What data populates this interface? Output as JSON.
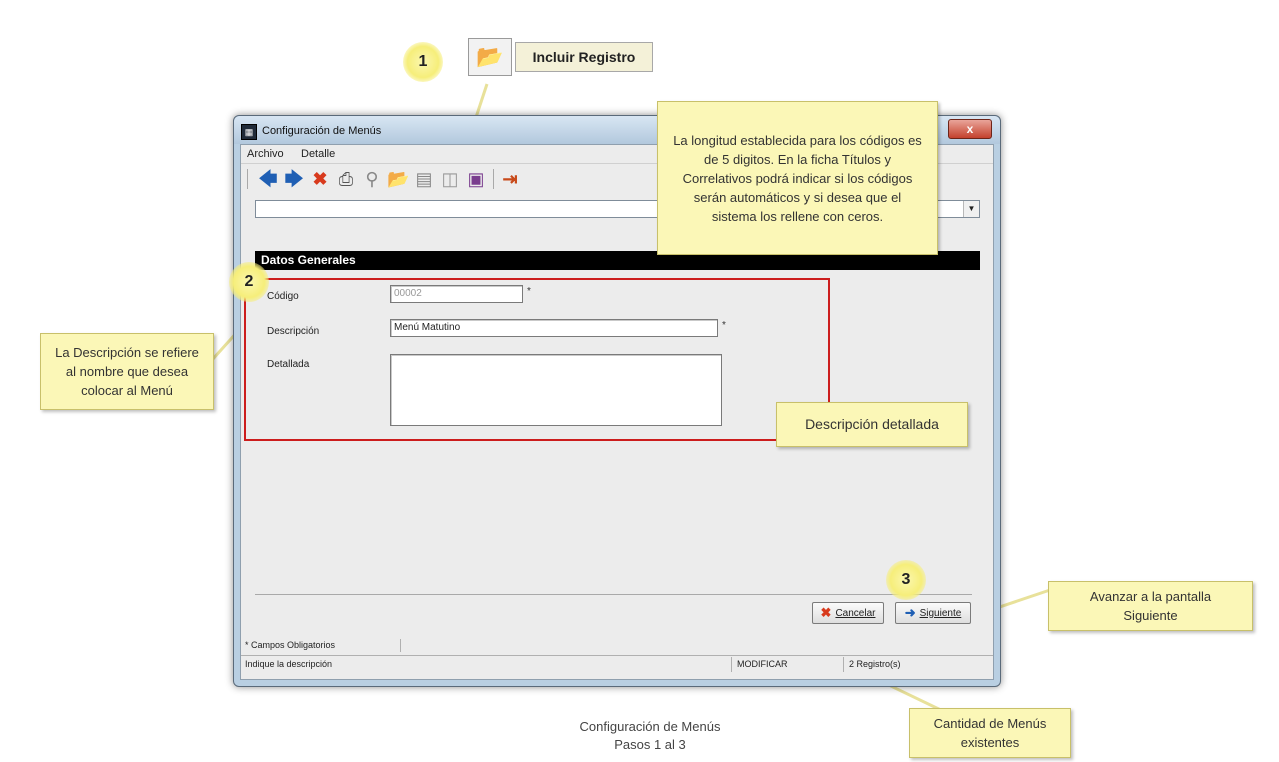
{
  "callout_top": {
    "step": "1",
    "button_label": "Incluir Registro"
  },
  "window": {
    "title": "Configuración de Menús",
    "close": "x",
    "menu": [
      "Archivo",
      "Detalle"
    ],
    "section_header": "Datos Generales",
    "fields": {
      "codigo_label": "Código",
      "codigo_value": "00002",
      "descripcion_label": "Descripción",
      "descripcion_value": "Menú Matutino",
      "detallada_label": "Detallada",
      "detallada_value": "",
      "required_mark": "*"
    },
    "buttons": {
      "cancel": "Cancelar",
      "next": "Siguiente"
    },
    "required_note": "* Campos Obligatorios",
    "status": {
      "hint": "Indique la descripción",
      "mode": "MODIFICAR",
      "count": "2 Registro(s)"
    }
  },
  "steps": {
    "two": "2",
    "three": "3"
  },
  "notes": {
    "codigo": "La longitud  establecida para los códigos es de 5 digitos. En la ficha Títulos y Correlativos podrá indicar si los códigos serán automáticos y si desea que el sistema los rellene con ceros.",
    "descripcion": "La Descripción se refiere al nombre que desea colocar al Menú",
    "detallada": "Descripción detallada",
    "siguiente": "Avanzar a la pantalla Siguiente",
    "cantidad": "Cantidad de Menús existentes"
  },
  "caption": {
    "line1": "Configuración de Menús",
    "line2": "Pasos 1 al 3"
  },
  "icons": [
    "back-arrow-icon",
    "forward-arrow-icon",
    "cancel-x-icon",
    "print-icon",
    "search-icon",
    "add-record-icon",
    "edit-icon",
    "delete-icon",
    "save-icon",
    "exit-icon"
  ],
  "colors": {
    "note_bg": "#fbf7b7",
    "header_bg": "#000000",
    "red_frame": "#cc1d1d",
    "nav_blue": "#1f5fb4"
  }
}
